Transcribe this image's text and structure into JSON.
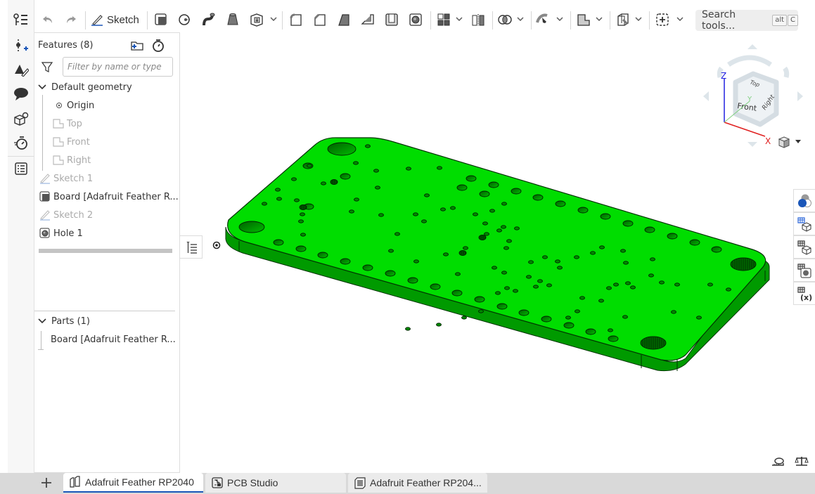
{
  "toolbar": {
    "sketch_label": "Sketch",
    "search_placeholder": "Search tools...",
    "search_shortcut": [
      "alt",
      "C"
    ],
    "tools": [
      "undo-icon",
      "redo-icon",
      "sketch-icon",
      "extrude-icon",
      "revolve-icon",
      "sweep-icon",
      "loft-icon",
      "thicken-icon",
      "fillet-icon",
      "chamfer-icon",
      "draft-icon",
      "rib-icon",
      "shell-icon",
      "hole-icon",
      "pattern-icon",
      "mirror-icon",
      "boolean-icon",
      "transform-icon",
      "plane-icon",
      "mate-connector-icon",
      "insert-icon"
    ]
  },
  "rail": {
    "items": [
      "feature-list-icon",
      "variable-icon",
      "appearance-icon",
      "comment-icon",
      "part-studio-help-icon",
      "rollback-timer-icon",
      "checklist-icon"
    ]
  },
  "feature_panel": {
    "title": "Features (8)",
    "filter_placeholder": "Filter by name or type",
    "default_geometry_label": "Default geometry",
    "geometry": [
      {
        "label": "Origin",
        "icon": "origin-icon",
        "dim": false
      },
      {
        "label": "Top",
        "icon": "plane-icon",
        "dim": true
      },
      {
        "label": "Front",
        "icon": "plane-icon",
        "dim": true
      },
      {
        "label": "Right",
        "icon": "plane-icon",
        "dim": true
      }
    ],
    "features": [
      {
        "label": "Sketch 1",
        "icon": "sketch-icon",
        "dim": true
      },
      {
        "label": "Board [Adafruit Feather R...",
        "icon": "extrude-icon",
        "dim": false
      },
      {
        "label": "Sketch 2",
        "icon": "sketch-icon",
        "dim": true
      },
      {
        "label": "Hole 1",
        "icon": "hole-icon",
        "dim": false
      }
    ],
    "parts_label": "Parts (1)",
    "parts": [
      "Board [Adafruit Feather R..."
    ]
  },
  "view_cube": {
    "faces": [
      "Top",
      "Front",
      "Right"
    ],
    "axes": [
      "X",
      "Y",
      "Z"
    ],
    "colors": {
      "x": "#e02020",
      "y": "#80d080",
      "z": "#2020e0"
    }
  },
  "model": {
    "color": "#00dd00",
    "edge_color": "#008800"
  },
  "bottom_tabs": [
    {
      "label": "Adafruit Feather RP2040",
      "icon": "assembly-icon",
      "active": true
    },
    {
      "label": "PCB Studio",
      "icon": "pcb-studio-icon",
      "active": false
    },
    {
      "label": "Adafruit Feather RP204...",
      "icon": "part-studio-icon",
      "active": false
    }
  ],
  "colors": {
    "accent": "#1a56b8",
    "active_tab_underline": "#1a56b8"
  }
}
